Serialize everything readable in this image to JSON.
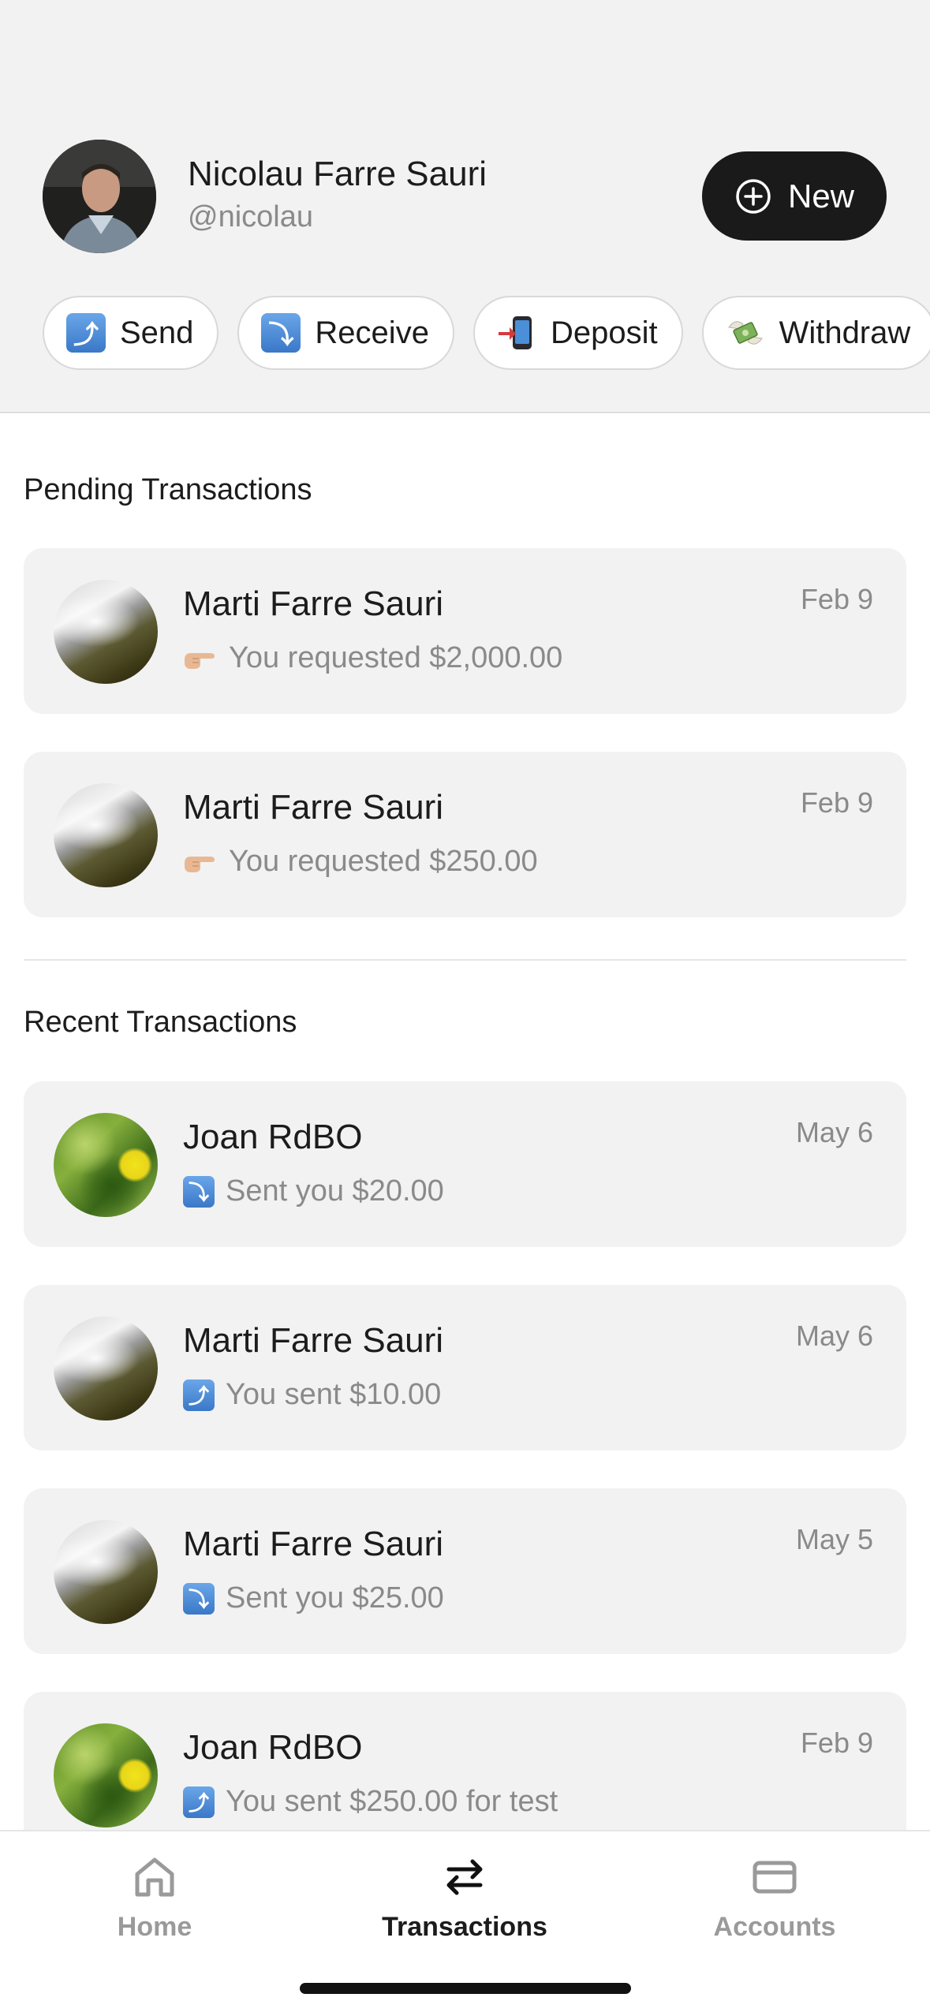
{
  "profile": {
    "name": "Nicolau Farre Sauri",
    "handle": "@nicolau"
  },
  "new_button": {
    "label": "New",
    "icon": "plus-circle-icon"
  },
  "actions": [
    {
      "label": "Send",
      "icon": "arrow-up-right-emoji"
    },
    {
      "label": "Receive",
      "icon": "arrow-down-right-emoji"
    },
    {
      "label": "Deposit",
      "icon": "phone-with-arrow-emoji"
    },
    {
      "label": "Withdraw",
      "icon": "money-with-wings-emoji"
    }
  ],
  "pending": {
    "title": "Pending Transactions",
    "items": [
      {
        "name": "Marti Farre Sauri",
        "desc": "You requested $2,000.00",
        "date": "Feb 9",
        "icon": "backhand-pointing-emoji",
        "avatar": "stone"
      },
      {
        "name": "Marti Farre Sauri",
        "desc": "You requested $250.00",
        "date": "Feb 9",
        "icon": "backhand-pointing-emoji",
        "avatar": "stone"
      }
    ]
  },
  "recent": {
    "title": "Recent Transactions",
    "items": [
      {
        "name": "Joan RdBO",
        "desc": "Sent you $20.00",
        "date": "May 6",
        "icon": "arrow-down-right-emoji",
        "avatar": "leaf"
      },
      {
        "name": "Marti Farre Sauri",
        "desc": "You sent $10.00",
        "date": "May 6",
        "icon": "arrow-up-right-emoji",
        "avatar": "stone"
      },
      {
        "name": "Marti Farre Sauri",
        "desc": "Sent you $25.00",
        "date": "May 5",
        "icon": "arrow-down-right-emoji",
        "avatar": "stone"
      },
      {
        "name": "Joan RdBO",
        "desc": "You sent $250.00 for test",
        "date": "Feb 9",
        "icon": "arrow-up-right-emoji",
        "avatar": "leaf"
      }
    ]
  },
  "tabbar": {
    "tabs": [
      {
        "label": "Home",
        "icon": "home-icon",
        "active": false
      },
      {
        "label": "Transactions",
        "icon": "swap-arrows-icon",
        "active": true
      },
      {
        "label": "Accounts",
        "icon": "card-icon",
        "active": false
      }
    ]
  }
}
